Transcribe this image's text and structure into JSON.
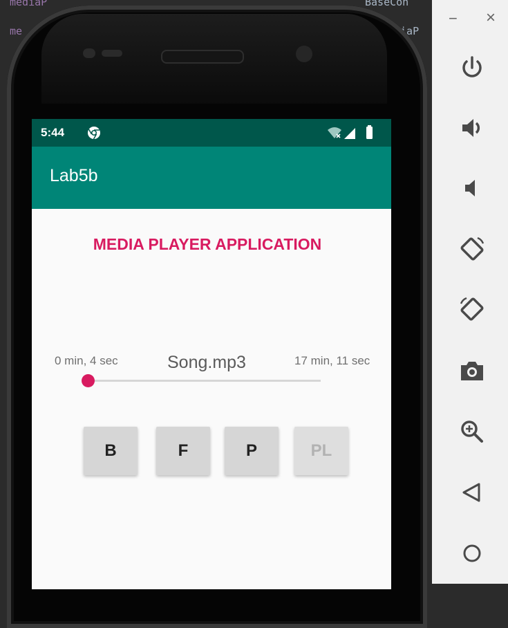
{
  "ide_fragments": {
    "line1_left": "mediaP",
    "line1_right": "BaseCon",
    "line2_left": "me",
    "line2_right": "diaP"
  },
  "status_bar": {
    "time": "5:44"
  },
  "app_bar": {
    "title": "Lab5b"
  },
  "main": {
    "heading": "MEDIA PLAYER APPLICATION",
    "current_time": "0 min, 4 sec",
    "song_name": "Song.mp3",
    "total_time": "17 min, 11 sec",
    "seek_progress": 0.004,
    "buttons": [
      {
        "label": "B",
        "enabled": true
      },
      {
        "label": "F",
        "enabled": true
      },
      {
        "label": "P",
        "enabled": true
      },
      {
        "label": "PL",
        "enabled": false
      }
    ]
  },
  "toolbar": {
    "minimize_label": "−",
    "close_label": "×",
    "items": [
      "power-icon",
      "volume-up-icon",
      "volume-down-icon",
      "rotate-left-icon",
      "rotate-right-icon",
      "camera-icon",
      "zoom-icon",
      "back-icon",
      "home-icon"
    ]
  },
  "colors": {
    "accent": "#d81b60",
    "app_bar": "#008577",
    "status_bar": "#00574b"
  }
}
